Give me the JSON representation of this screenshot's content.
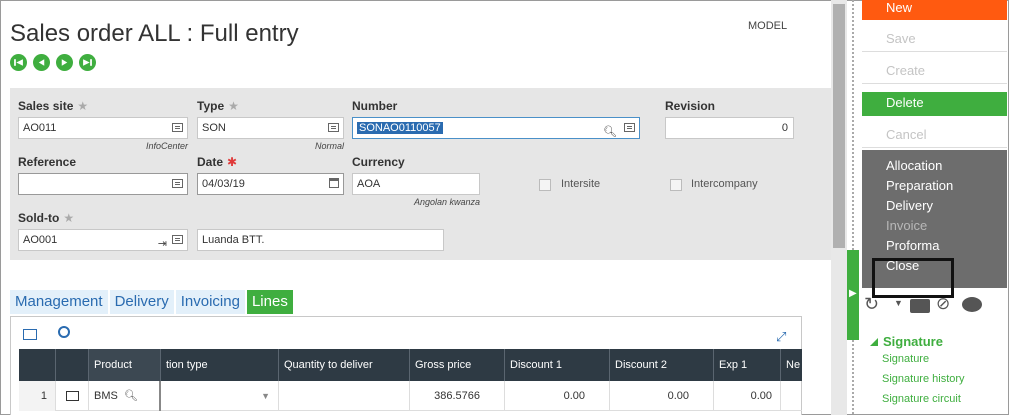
{
  "page": {
    "title": "Sales order ALL : Full entry",
    "model_label": "MODEL"
  },
  "form": {
    "sales_site": {
      "label": "Sales site",
      "value": "AO011",
      "sub": "InfoCenter"
    },
    "type": {
      "label": "Type",
      "value": "SON",
      "sub": "Normal"
    },
    "number": {
      "label": "Number",
      "value": "SONAO0110057"
    },
    "revision": {
      "label": "Revision",
      "value": "0"
    },
    "reference": {
      "label": "Reference",
      "value": ""
    },
    "date": {
      "label": "Date",
      "value": "04/03/19"
    },
    "currency": {
      "label": "Currency",
      "value": "AOA",
      "sub": "Angolan kwanza"
    },
    "intersite": {
      "label": "Intersite"
    },
    "intercompany": {
      "label": "Intercompany"
    },
    "sold_to": {
      "label": "Sold-to",
      "value": "AO001",
      "name": "Luanda BTT."
    }
  },
  "tabs": [
    "Management",
    "Delivery",
    "Invoicing",
    "Lines"
  ],
  "grid": {
    "columns": [
      "Product",
      "tion type",
      "Quantity to deliver",
      "Gross price",
      "Discount 1",
      "Discount 2",
      "Exp 1",
      "Ne"
    ],
    "rows": [
      {
        "num": "1",
        "product": "BMS",
        "gross_price": "386.5766",
        "discount1": "0.00",
        "discount2": "0.00",
        "exp1": "0.00"
      }
    ]
  },
  "actions": {
    "new": "New",
    "save": "Save",
    "create": "Create",
    "delete": "Delete",
    "cancel": "Cancel"
  },
  "menu": [
    "Allocation",
    "Preparation",
    "Delivery",
    "Invoice",
    "Proforma",
    "Close"
  ],
  "signature": {
    "header": "Signature",
    "links": [
      "Signature",
      "Signature history",
      "Signature circuit"
    ]
  },
  "colors": {
    "accent_green": "#3fae3f",
    "new_orange": "#ff5a10",
    "menu_gray": "#6d6d6d"
  }
}
